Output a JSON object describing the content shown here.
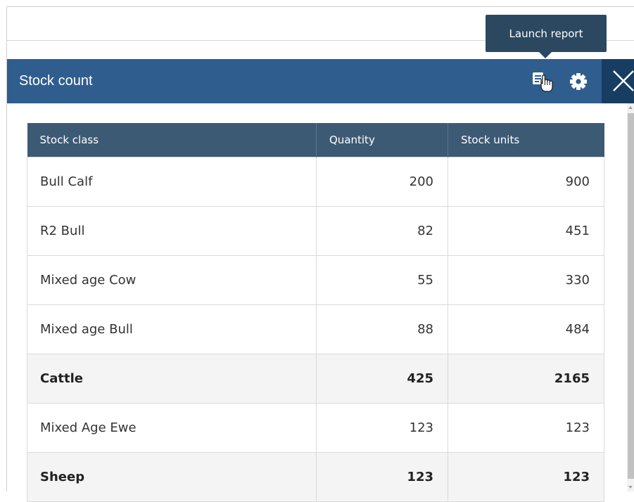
{
  "tooltip": {
    "text": "Launch report"
  },
  "header": {
    "title": "Stock count"
  },
  "icons": {
    "report": "launch-report-icon",
    "settings": "gear-icon",
    "close": "close-icon"
  },
  "colors": {
    "header_bg": "#2f5d8e",
    "table_header_bg": "#3d5a75",
    "close_bg": "#173d63",
    "total_row_bg": "#f4f4f4"
  },
  "table": {
    "columns": [
      "Stock class",
      "Quantity",
      "Stock units"
    ],
    "rows": [
      {
        "class": "Bull Calf",
        "quantity": "200",
        "units": "900",
        "total": false
      },
      {
        "class": "R2 Bull",
        "quantity": "82",
        "units": "451",
        "total": false
      },
      {
        "class": "Mixed age Cow",
        "quantity": "55",
        "units": "330",
        "total": false
      },
      {
        "class": "Mixed age Bull",
        "quantity": "88",
        "units": "484",
        "total": false
      },
      {
        "class": "Cattle",
        "quantity": "425",
        "units": "2165",
        "total": true
      },
      {
        "class": "Mixed Age Ewe",
        "quantity": "123",
        "units": "123",
        "total": false
      },
      {
        "class": "Sheep",
        "quantity": "123",
        "units": "123",
        "total": true
      }
    ]
  }
}
